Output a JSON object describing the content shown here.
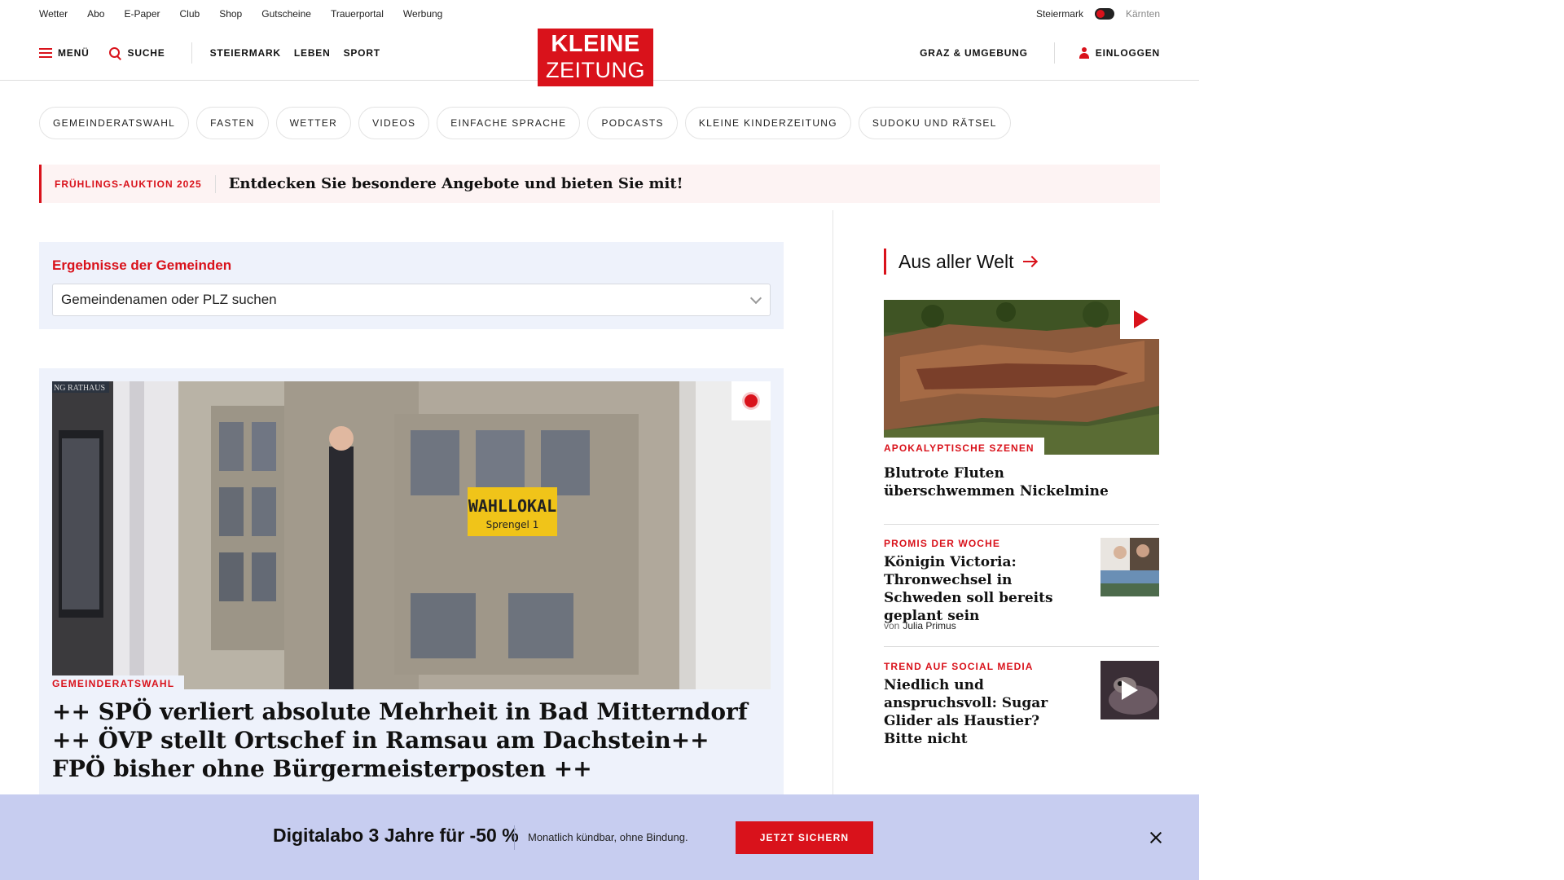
{
  "utility": {
    "links": [
      "Wetter",
      "Abo",
      "E-Paper",
      "Club",
      "Shop",
      "Gutscheine",
      "Trauerportal",
      "Werbung"
    ],
    "region_active": "Steiermark",
    "region_other": "Kärnten"
  },
  "header": {
    "menu_label": "MENÜ",
    "search_label": "SUCHE",
    "nav": [
      "STEIERMARK",
      "LEBEN",
      "SPORT"
    ],
    "logo_line1": "KLEINE",
    "logo_line2": "ZEITUNG",
    "local_label": "GRAZ & UMGEBUNG",
    "login_label": "EINLOGGEN"
  },
  "chips": [
    "GEMEINDERATSWAHL",
    "FASTEN",
    "WETTER",
    "VIDEOS",
    "EINFACHE SPRACHE",
    "PODCASTS",
    "KLEINE KINDERZEITUNG",
    "SUDOKU UND RÄTSEL"
  ],
  "promo": {
    "tag": "FRÜHLINGS-AUKTION 2025",
    "text": "Entdecken Sie besondere Angebote und bieten Sie mit!"
  },
  "gemeinde": {
    "title": "Ergebnisse der Gemeinden",
    "placeholder": "Gemeindenamen oder PLZ suchen"
  },
  "main_teaser": {
    "photo_sign_rathaus": "NG RATHAUS",
    "photo_sign_wahllokal": "WAHLLOKAL",
    "photo_sign_sprengel": "Sprengel 1",
    "kicker": "GEMEINDERATSWAHL",
    "headline_line1": "++ SPÖ verliert absolute Mehrheit in Bad Mitterndorf",
    "headline_line2": "++ ÖVP stellt Ortschef in Ramsau am Dachstein++",
    "headline_line3": "FPÖ bisher ohne Bürgermeisterposten ++"
  },
  "sidebar": {
    "section_title": "Aus aller Welt",
    "lead": {
      "kicker": "APOKALYPTISCHE SZENEN",
      "headline": "Blutrote Fluten überschwemmen Nickelmine"
    },
    "items": [
      {
        "kicker": "PROMIS DER WOCHE",
        "headline": "Königin Victoria: Thronwechsel in Schweden soll bereits geplant sein",
        "author_prefix": "von",
        "author": "Julia Primus"
      },
      {
        "kicker": "TREND AUF SOCIAL MEDIA",
        "headline": "Niedlich und anspruchsvoll: Sugar Glider als Haustier? Bitte nicht"
      }
    ]
  },
  "banner": {
    "title": "Digitalabo 3 Jahre für -50 %",
    "subtitle": "Monatlich kündbar, ohne Bindung.",
    "cta": "JETZT SICHERN"
  },
  "colors": {
    "brand_red": "#d9121b",
    "teaser_bg": "#eef2fb",
    "banner_bg": "#c7cdf0",
    "promo_bg": "#fdf3f3"
  }
}
